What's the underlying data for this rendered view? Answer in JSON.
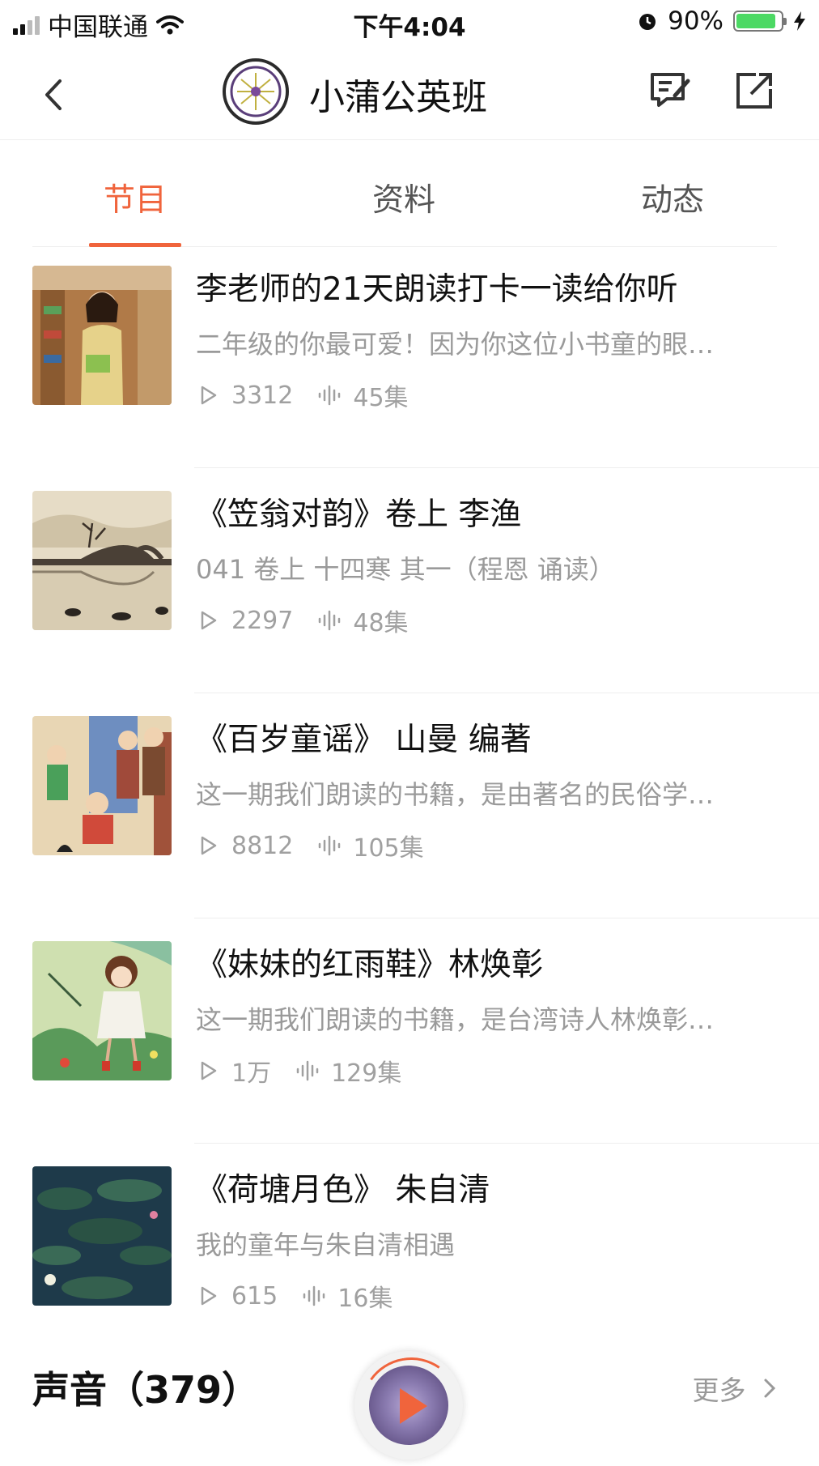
{
  "status_bar": {
    "carrier": "中国联通",
    "time": "下午4:04",
    "battery": "90%",
    "battery_level": 0.9
  },
  "nav": {
    "title": "小蒲公英班"
  },
  "tabs": [
    {
      "label": "节目",
      "active": true
    },
    {
      "label": "资料",
      "active": false
    },
    {
      "label": "动态",
      "active": false
    }
  ],
  "programs": [
    {
      "title": "李老师的21天朗读打卡一读给你听",
      "desc": "二年级的你最可爱！因为你这位小书童的眼…",
      "plays": "3312",
      "episodes": "45集",
      "cover": "teacher-photo"
    },
    {
      "title": "《笠翁对韵》卷上 李渔",
      "desc": "041 卷上 十四寒 其一（程恩 诵读）",
      "plays": "2297",
      "episodes": "48集",
      "cover": "bridge-painting"
    },
    {
      "title": "《百岁童谣》 山曼 编著",
      "desc": "这一期我们朗读的书籍，是由著名的民俗学…",
      "plays": "8812",
      "episodes": "105集",
      "cover": "folk-illustration"
    },
    {
      "title": "《妹妹的红雨鞋》林焕彰",
      "desc": "这一期我们朗读的书籍，是台湾诗人林焕彰…",
      "plays": "1万",
      "episodes": "129集",
      "cover": "girl-rain-illustration"
    },
    {
      "title": "《荷塘月色》 朱自清",
      "desc": "我的童年与朱自清相遇",
      "plays": "615",
      "episodes": "16集",
      "cover": "lotus-pond"
    }
  ],
  "sound_section": {
    "heading": "声音（379）",
    "more": "更多"
  },
  "colors": {
    "accent": "#f0643c",
    "battery": "#4cd964"
  }
}
